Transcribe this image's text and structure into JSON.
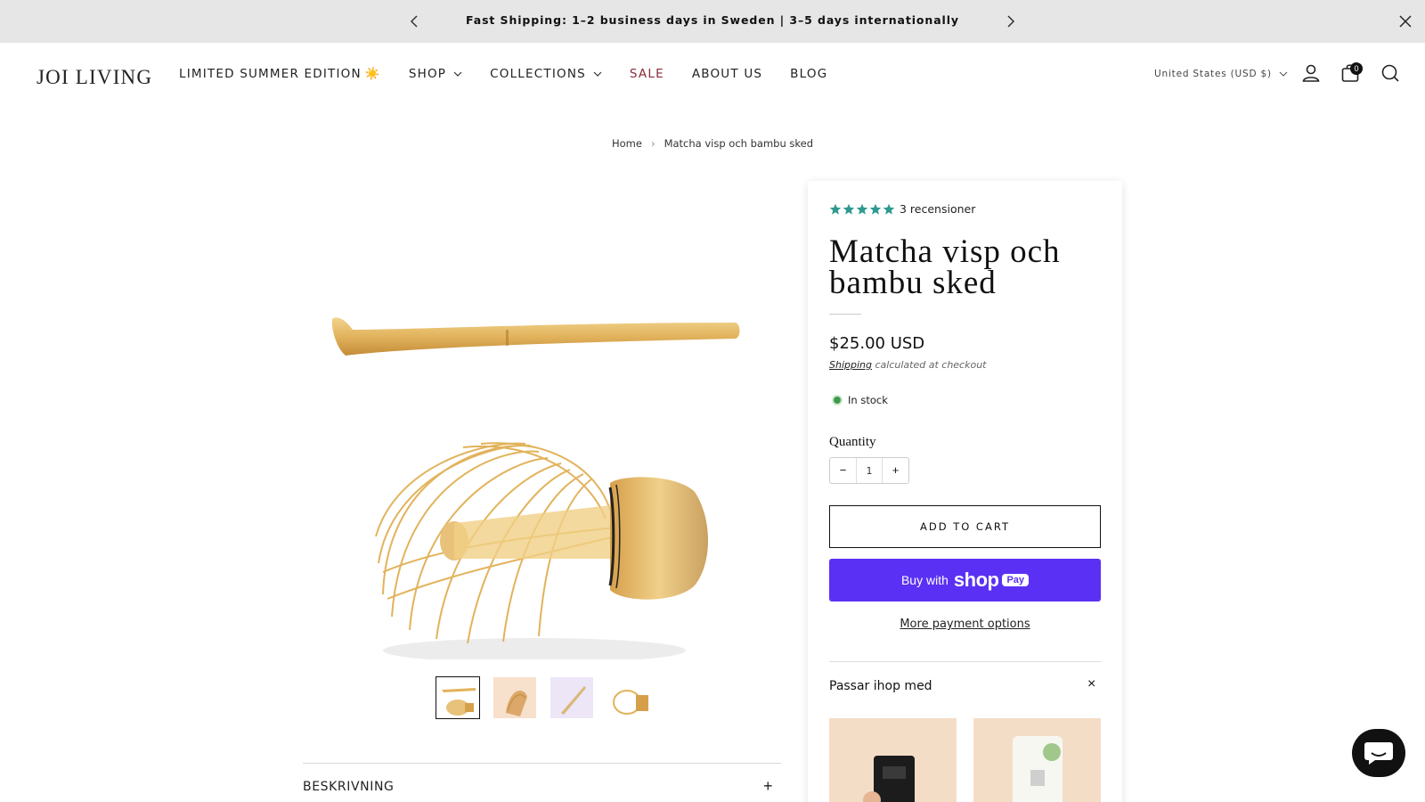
{
  "announcement": {
    "text": "Fast Shipping: 1–2 business days in Sweden | 3–5 days internationally"
  },
  "header": {
    "logo": "JOI LIVING",
    "nav": [
      {
        "label": "LIMITED SUMMER EDITION",
        "emoji": "☀️"
      },
      {
        "label": "SHOP"
      },
      {
        "label": "COLLECTIONS"
      },
      {
        "label": "SALE"
      },
      {
        "label": "ABOUT US"
      },
      {
        "label": "BLOG"
      }
    ],
    "currency": "United States (USD $)",
    "cart_count": "0"
  },
  "breadcrumb": {
    "home": "Home",
    "current": "Matcha visp och bambu sked"
  },
  "product": {
    "reviews": "3 recensioner",
    "rating": 5,
    "title": "Matcha visp och bambu sked",
    "price": "$25.00 USD",
    "shipping_link": "Shipping",
    "shipping_note": "calculated at checkout",
    "stock": "In stock",
    "quantity_label": "Quantity",
    "quantity": "1",
    "minus": "−",
    "plus": "+",
    "add_to_cart": "ADD TO CART",
    "buy_with": "Buy with",
    "shop_brand": "shop",
    "shop_pay": "Pay",
    "more_payment": "More payment options",
    "pairs_title": "Passar ihop med",
    "pairs_close": "×",
    "description_title": "BESKRIVNING",
    "description_toggle": "+"
  },
  "colors": {
    "accent_star": "#2e9a8f",
    "sale": "#8a2b3a",
    "shop_pay": "#5a31f4",
    "in_stock": "#3f9a4b"
  }
}
